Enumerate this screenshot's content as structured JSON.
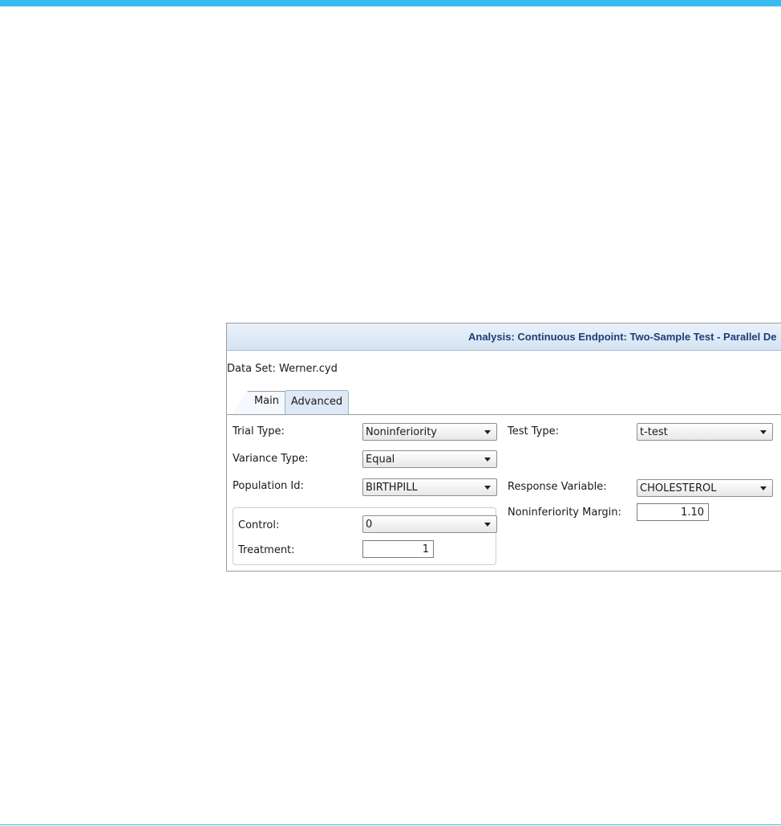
{
  "panel": {
    "title": "Analysis: Continuous Endpoint: Two-Sample Test - Parallel De",
    "dataset_label": "Data Set: Werner.cyd"
  },
  "tabs": [
    {
      "label": "Main",
      "active": true
    },
    {
      "label": "Advanced",
      "active": false
    }
  ],
  "form": {
    "trial_type": {
      "label": "Trial Type:",
      "value": "Noninferiority"
    },
    "test_type": {
      "label": "Test Type:",
      "value": "t-test"
    },
    "variance_type": {
      "label": "Variance Type:",
      "value": "Equal"
    },
    "population_id": {
      "label": "Population Id:",
      "value": "BIRTHPILL"
    },
    "response_variable": {
      "label": "Response Variable:",
      "value": "CHOLESTEROL"
    },
    "noninferiority_margin": {
      "label": "Noninferiority Margin:",
      "value": "1.10"
    },
    "control": {
      "label": "Control:",
      "value": "0"
    },
    "treatment": {
      "label": "Treatment:",
      "value": "1"
    }
  },
  "colors": {
    "accent": "#3bbcf0",
    "header_text": "#1d3f77"
  }
}
